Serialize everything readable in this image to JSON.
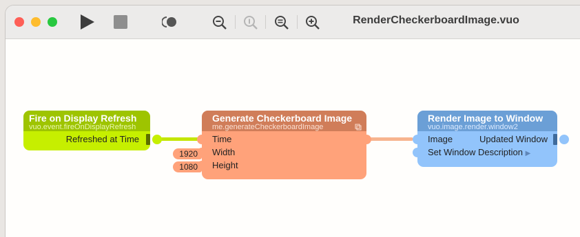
{
  "window": {
    "title": "RenderCheckerboardImage.vuo",
    "colors": {
      "close": "#fe5f57",
      "minimize": "#febc2e",
      "zoom": "#28c840"
    }
  },
  "toolbar": {
    "run": "play-icon",
    "stop": "stop-icon",
    "show_events": "show-events-icon",
    "zoom_out": "zoom-out-icon",
    "zoom_actual": "zoom-actual-size-icon",
    "zoom_to_fit": "zoom-to-fit-icon",
    "zoom_in": "zoom-in-icon"
  },
  "nodes": {
    "fire": {
      "title": "Fire on Display Refresh",
      "class_name": "vuo.event.fireOnDisplayRefresh",
      "output": "Refreshed at Time",
      "color": "#c4e600"
    },
    "checker": {
      "title": "Generate Checkerboard Image",
      "class_name": "me.generateCheckerboardImage",
      "inputs": [
        "Time",
        "Width",
        "Height"
      ],
      "width_value": "1920",
      "height_value": "1080",
      "color": "#f2a07a"
    },
    "render": {
      "title": "Render Image to Window",
      "class_name": "vuo.image.render.window2",
      "inputs": [
        "Image",
        "Set Window Description"
      ],
      "output": "Updated Window",
      "more_indicator": "▶",
      "color": "#8ec0f7"
    }
  }
}
